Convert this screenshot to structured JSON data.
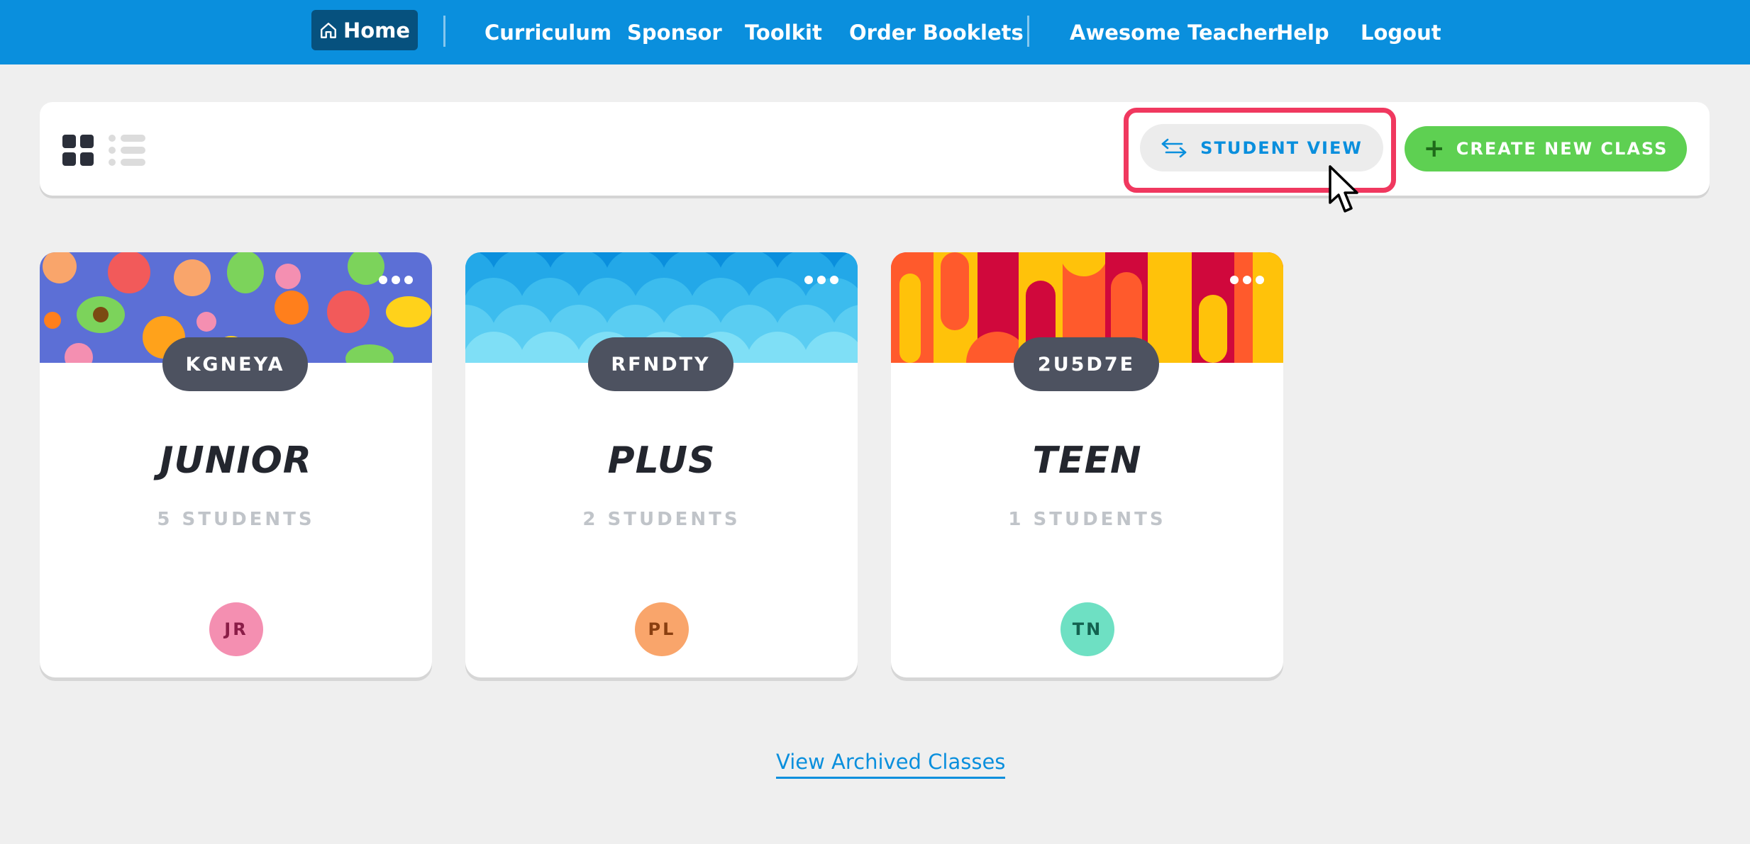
{
  "nav": {
    "home": "Home",
    "items": [
      "Curriculum",
      "Sponsor",
      "Toolkit",
      "Order Booklets"
    ],
    "user_items": [
      "Awesome Teacher",
      "Help",
      "Logout"
    ]
  },
  "toolbar": {
    "student_view": "STUDENT VIEW",
    "create_class": "CREATE NEW CLASS"
  },
  "classes": [
    {
      "code": "KGNEYA",
      "name": "JUNIOR",
      "students": "5 STUDENTS",
      "avatar": "JR",
      "avatar_bg": "#f48fb1",
      "avatar_fg": "#8a1d47"
    },
    {
      "code": "RFNDTY",
      "name": "PLUS",
      "students": "2 STUDENTS",
      "avatar": "PL",
      "avatar_bg": "#f9a56b",
      "avatar_fg": "#8a3f10"
    },
    {
      "code": "2U5D7E",
      "name": "TEEN",
      "students": "1 STUDENTS",
      "avatar": "TN",
      "avatar_bg": "#6ee0c3",
      "avatar_fg": "#13614f"
    }
  ],
  "archived_link": "View Archived Classes",
  "colors": {
    "nav_bg": "#0a8fdd",
    "home_bg": "#06517e",
    "accent_green": "#5ed052",
    "highlight": "#f0385f"
  }
}
